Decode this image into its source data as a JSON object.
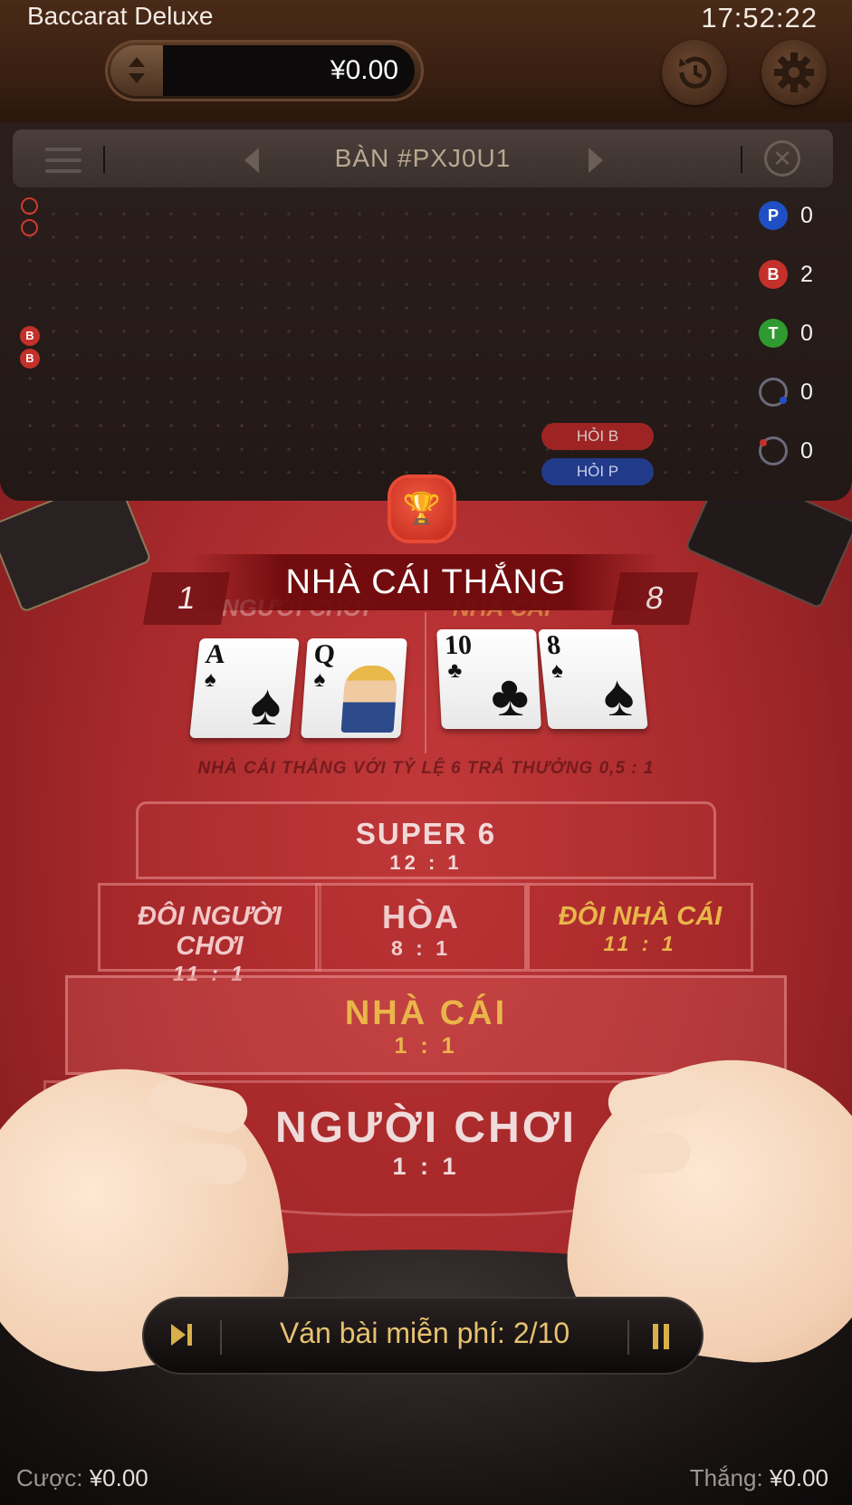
{
  "header": {
    "title": "Baccarat Deluxe",
    "time": "17:52:22",
    "balance": "¥0.00"
  },
  "scoreboard": {
    "table_id": "BÀN #PXJ0U1",
    "road_rings": 2,
    "road_beads": [
      "B",
      "B"
    ],
    "ask_banker": "HỎI B",
    "ask_player": "HỎI P",
    "stats": [
      {
        "icon": "P",
        "value": "0",
        "color": "#1f4fc4"
      },
      {
        "icon": "B",
        "value": "2",
        "color": "#c4302a"
      },
      {
        "icon": "T",
        "value": "0",
        "color": "#2f9a2f"
      },
      {
        "icon": "",
        "value": "0",
        "color": "#1f4fc4"
      },
      {
        "icon": "",
        "value": "0",
        "color": "#c4302a"
      }
    ]
  },
  "result": {
    "banner": "NHÀ CÁI THẮNG",
    "player_score": "1",
    "banker_score": "8",
    "player_label": "NGƯỜI CHƠI",
    "banker_label": "NHÀ CÁI",
    "note": "NHÀ CÁI THẮNG VỚI TỶ LỆ 6 TRẢ THƯỞNG 0,5 : 1"
  },
  "cards": {
    "player": [
      {
        "rank": "A",
        "suit": "♠",
        "icon": "ace-of-spades-card"
      },
      {
        "rank": "Q",
        "suit": "♠",
        "icon": "queen-of-spades-card"
      }
    ],
    "banker": [
      {
        "rank": "10",
        "suit": "♣",
        "icon": "ten-of-clubs-card"
      },
      {
        "rank": "8",
        "suit": "♠",
        "icon": "eight-of-spades-card"
      }
    ]
  },
  "bets": {
    "super6": {
      "name": "SUPER 6",
      "odds": "12 : 1"
    },
    "player_pair": {
      "name": "ĐÔI NGƯỜI CHƠI",
      "odds": "11 : 1"
    },
    "tie": {
      "name": "HÒA",
      "odds": "8 : 1"
    },
    "banker_pair": {
      "name": "ĐÔI NHÀ CÁI",
      "odds": "11 : 1"
    },
    "banker": {
      "name": "NHÀ CÁI",
      "odds": "1 : 1"
    },
    "player": {
      "name": "NGƯỜI CHƠI",
      "odds": "1 : 1"
    }
  },
  "controls": {
    "free_rounds": "Ván bài miễn phí: 2/10"
  },
  "footer": {
    "bet_label": "Cược:",
    "bet_value": "¥0.00",
    "win_label": "Thắng:",
    "win_value": "¥0.00"
  },
  "colors": {
    "felt": "#a82a2c",
    "gold": "#e9b54a",
    "player_blue": "#1f4fc4",
    "banker_red": "#c4302a"
  }
}
